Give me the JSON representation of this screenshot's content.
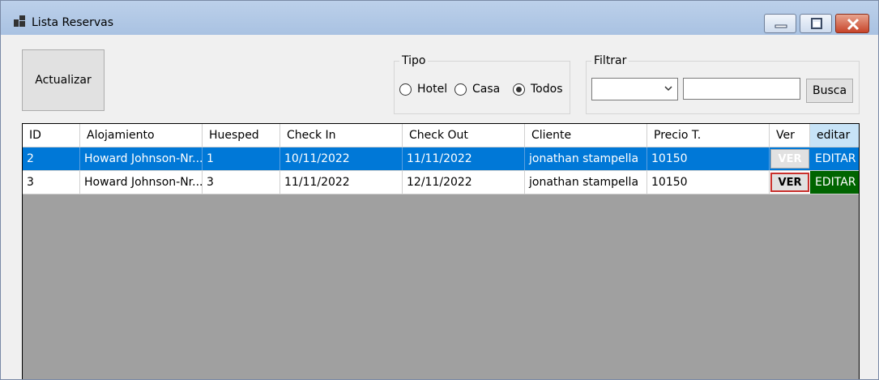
{
  "window": {
    "title": "Lista Reservas",
    "icon": "window-app-icon",
    "controls": [
      "minimize-icon",
      "maximize-icon",
      "close-icon"
    ]
  },
  "toolbar": {
    "refresh_label": "Actualizar"
  },
  "tipo": {
    "label": "Tipo",
    "options": [
      {
        "label": "Hotel",
        "checked": false
      },
      {
        "label": "Casa",
        "checked": false
      },
      {
        "label": "Todos",
        "checked": true
      }
    ]
  },
  "filtrar": {
    "label": "Filtrar",
    "select_value": "",
    "text_value": "",
    "search_label": "Busca"
  },
  "table": {
    "columns": [
      "ID",
      "Alojamiento",
      "Huesped",
      "Check In",
      "Check Out",
      "Cliente",
      "Precio T.",
      "Ver",
      "editar"
    ],
    "rows": [
      {
        "id": "2",
        "alojamiento": "Howard Johnson-Nr...",
        "huesped": "1",
        "check_in": "10/11/2022",
        "check_out": "11/11/2022",
        "cliente": "jonathan stampella",
        "precio": "10150",
        "ver": "VER",
        "editar": "EDITAR",
        "selected": true
      },
      {
        "id": "3",
        "alojamiento": "Howard Johnson-Nr...",
        "huesped": "3",
        "check_in": "11/11/2022",
        "check_out": "12/11/2022",
        "cliente": "jonathan stampella",
        "precio": "10150",
        "ver": "VER",
        "editar": "EDITAR",
        "selected": false
      }
    ]
  },
  "colors": {
    "selection": "#0078d7",
    "editar_header": "#c7e3f7",
    "editar_green": "#006400",
    "grid_background": "#a0a0a0",
    "ver_focus_border": "#c9302c"
  }
}
